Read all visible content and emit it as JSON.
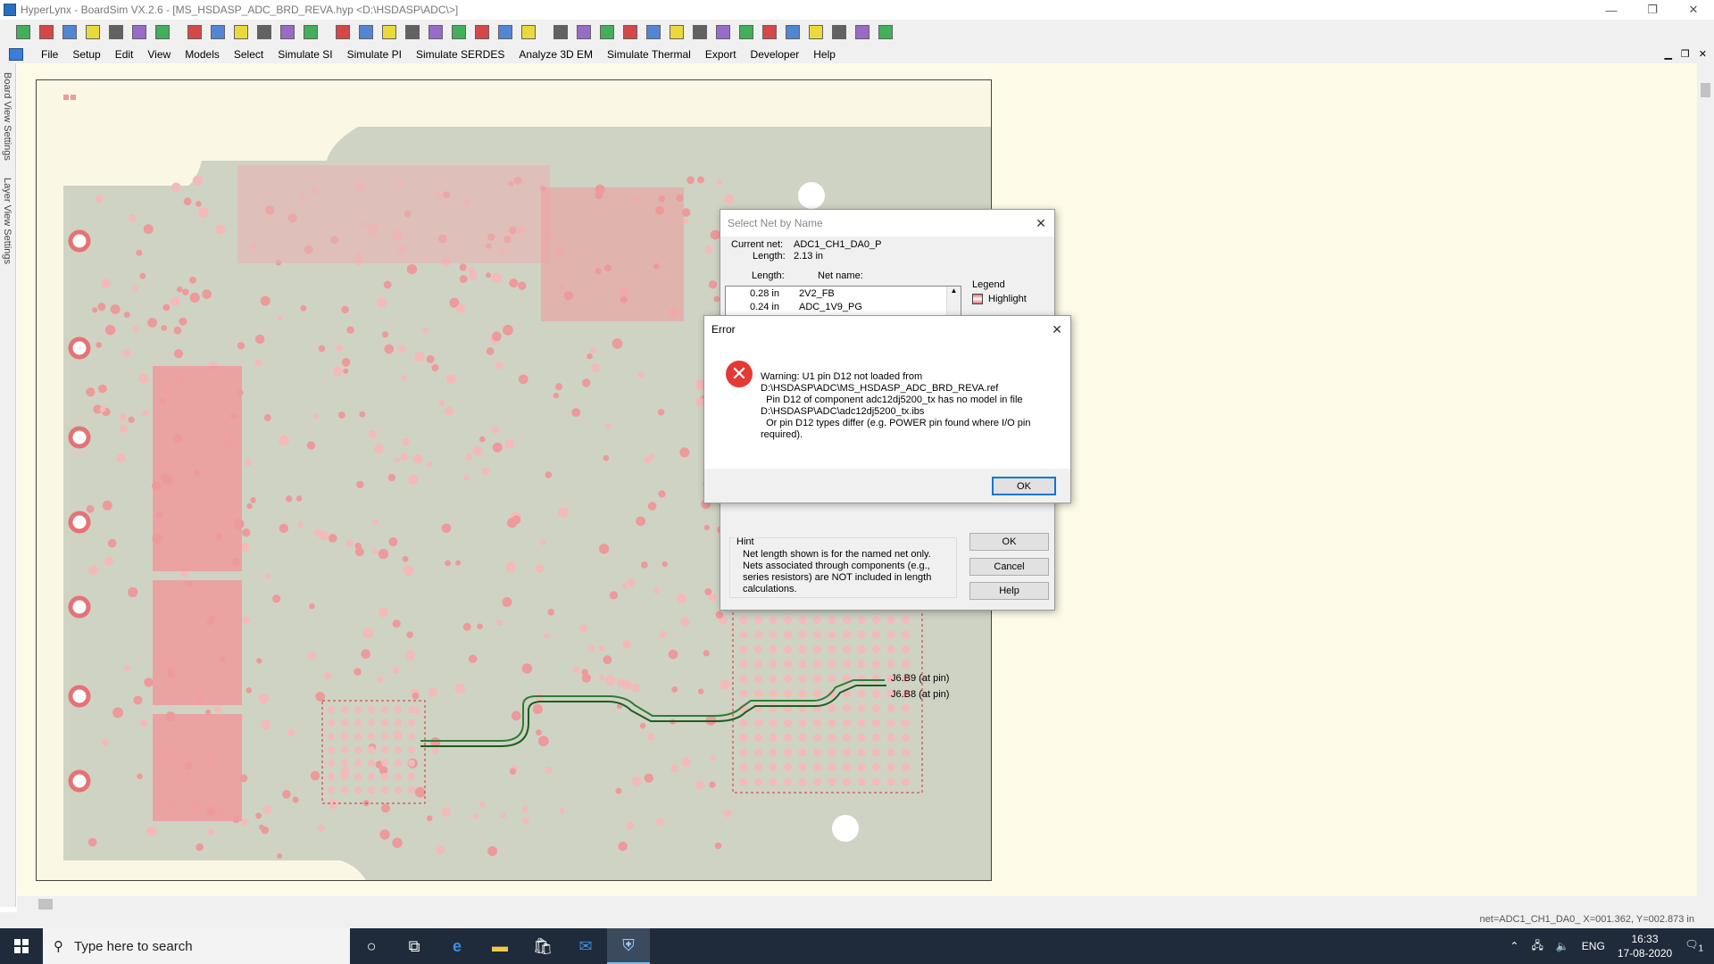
{
  "window": {
    "title": "HyperLynx - BoardSim VX.2.6 - [MS_HSDASP_ADC_BRD_REVA.hyp <D:\\HSDASP\\ADC\\>]",
    "minimize_glyph": "—",
    "restore_glyph": "❐",
    "close_glyph": "✕"
  },
  "toolbar": {
    "icons": [
      "new-board-icon",
      "open-icon",
      "save-icon",
      "print-preview-icon",
      "print-icon",
      "edit-board-icon",
      "edit-stackup-icon",
      "zoom-in-icon",
      "zoom-out-icon",
      "zoom-fit-icon",
      "vias-icon",
      "pads-icon",
      "blank-icon",
      "select-net-icon",
      "terminator-wizard-icon",
      "crosstalk-icon",
      "probes-icon",
      "eye-icon",
      "oscilloscope-icon",
      "spectrum-icon",
      "batch-icon",
      "emc-icon",
      "sparams-icon",
      "dc-drop-icon",
      "decap-icon",
      "plane-noise-icon",
      "impedance-icon",
      "sweep-icon",
      "report-icon",
      "layer-icon",
      "via-model-icon",
      "waveform-icon",
      "channel-icon",
      "tdr-icon",
      "thermal-icon",
      "power-icon",
      "help-icon"
    ],
    "colors": {
      "accent_green": "#0a9a2a",
      "accent_red": "#cc1111",
      "accent_yellow": "#e8d200"
    }
  },
  "menu": {
    "items": [
      "File",
      "Setup",
      "Edit",
      "View",
      "Models",
      "Select",
      "Simulate SI",
      "Simulate PI",
      "Simulate SERDES",
      "Analyze 3D EM",
      "Simulate Thermal",
      "Export",
      "Developer",
      "Help"
    ],
    "mdi_minimize": "▁",
    "mdi_restore": "❐",
    "mdi_close": "✕"
  },
  "side_tabs": {
    "board_view": "Board View Settings",
    "layer_view": "Layer View Settings"
  },
  "board": {
    "colors": {
      "copper": "#ef9a9a",
      "pad": "#f4b9b9",
      "ground": "#cfd8c8",
      "trace_green": "#2e7d32"
    },
    "pin_labels": [
      "J6.B9 (at pin)",
      "J6.B8 (at pin)"
    ]
  },
  "status": {
    "text": "net=ADC1_CH1_DA0_  X=001.362, Y=002.873 in"
  },
  "select_net_dialog": {
    "title": "Select Net by Name",
    "current_net_label": "Current net:",
    "current_net_value": "ADC1_CH1_DA0_P",
    "length_label": "Length:",
    "length_value": "2.13 in",
    "col_length": "Length:",
    "col_name": "Net name:",
    "rows": [
      {
        "length": "0.28 in",
        "name": "2V2_FB"
      },
      {
        "length": "0.24 in",
        "name": "ADC_1V9_PG"
      }
    ],
    "legend_label": "Legend",
    "legend_item": "Highlight",
    "hint_label": "Hint",
    "hint_text": "Net length shown is for the named net only. Nets associated through components (e.g., series resistors) are NOT included in length calculations.",
    "ok": "OK",
    "cancel": "Cancel",
    "help": "Help"
  },
  "error_dialog": {
    "title": "Error",
    "message": "Warning: U1 pin D12 not loaded from\nD:\\HSDASP\\ADC\\MS_HSDASP_ADC_BRD_REVA.ref\n  Pin D12 of component adc12dj5200_tx has no model in file\nD:\\HSDASP\\ADC\\adc12dj5200_tx.ibs\n  Or pin D12 types differ (e.g. POWER pin found where I/O pin\nrequired).",
    "ok": "OK",
    "icon_glyph": "✕"
  },
  "taskbar": {
    "search_placeholder": "Type here to search",
    "language": "ENG",
    "time": "16:33",
    "date": "17-08-2020",
    "notification_count": "1"
  }
}
